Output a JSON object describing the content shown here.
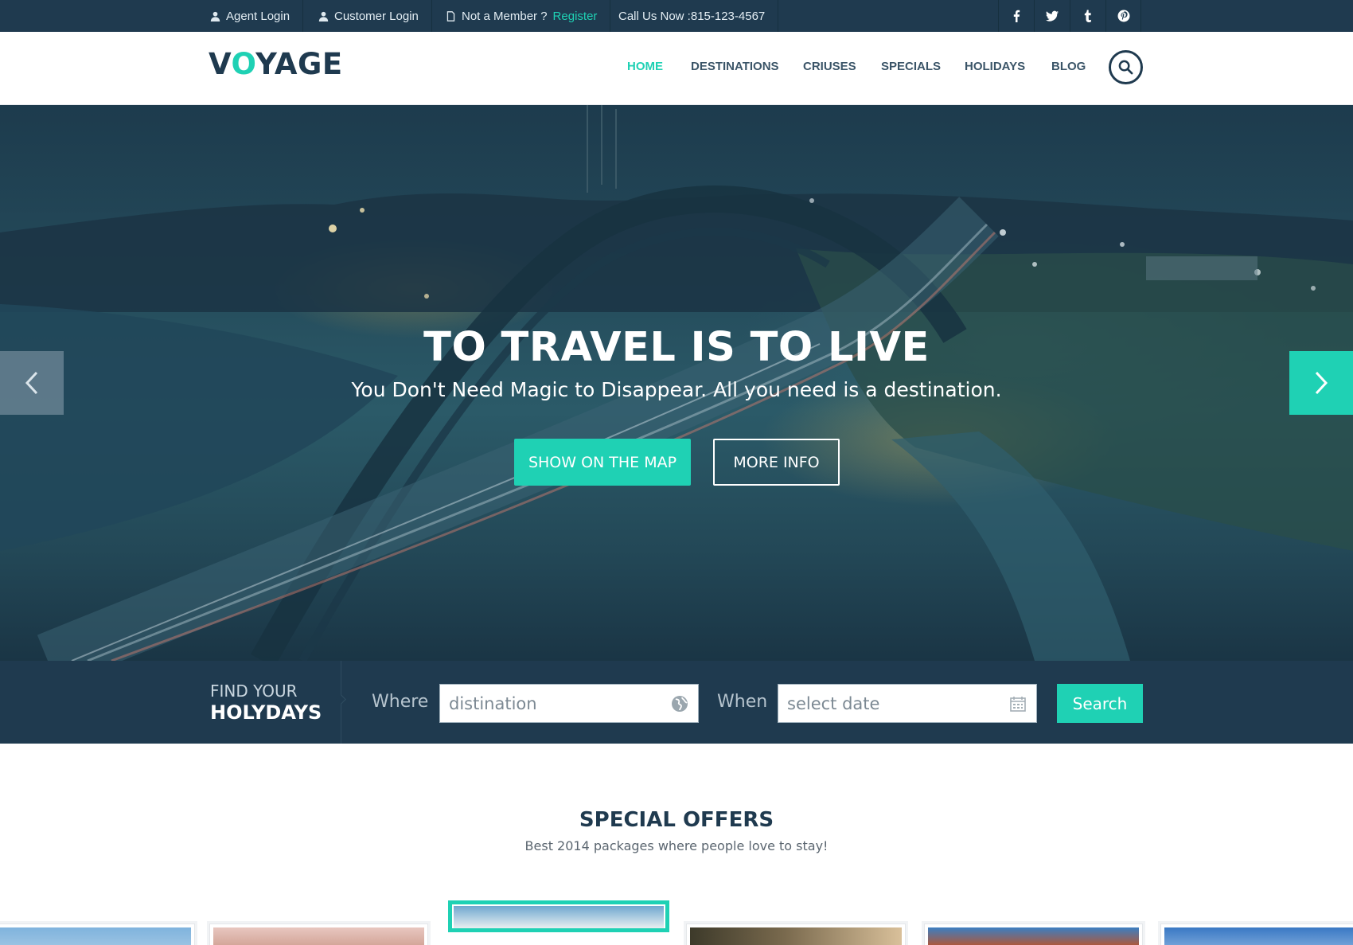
{
  "topbar": {
    "agent_login": "Agent Login",
    "customer_login": "Customer Login",
    "not_member": "Not a Member ?",
    "register": "Register",
    "call": "Call Us Now :815-123-4567",
    "social": [
      "facebook-icon",
      "twitter-icon",
      "tumblr-icon",
      "pinterest-icon"
    ]
  },
  "header": {
    "logo_v": "V",
    "logo_o": "O",
    "logo_rest": "YAGE",
    "nav": [
      "HOME",
      "DESTINATIONS",
      "CRIUSES",
      "SPECIALS",
      "HOLIDAYS",
      "BLOG"
    ],
    "active_nav": "HOME"
  },
  "hero": {
    "title": "TO TRAVEL IS TO LIVE",
    "subtitle": "You Don't Need Magic to Disappear. All you need is a destination.",
    "btn_map": "SHOW ON THE MAP",
    "btn_info": "MORE INFO"
  },
  "search": {
    "find_line1": "FIND YOUR",
    "find_line2": "HOLYDAYS",
    "where_label": "Where",
    "where_placeholder": "distination",
    "when_label": "When",
    "when_placeholder": "select date",
    "button": "Search"
  },
  "offers": {
    "title": "SPECIAL OFFERS",
    "subtitle": "Best 2014 packages where people love to stay!"
  },
  "colors": {
    "accent": "#1fd1b4",
    "navy": "#1f3a4f"
  }
}
